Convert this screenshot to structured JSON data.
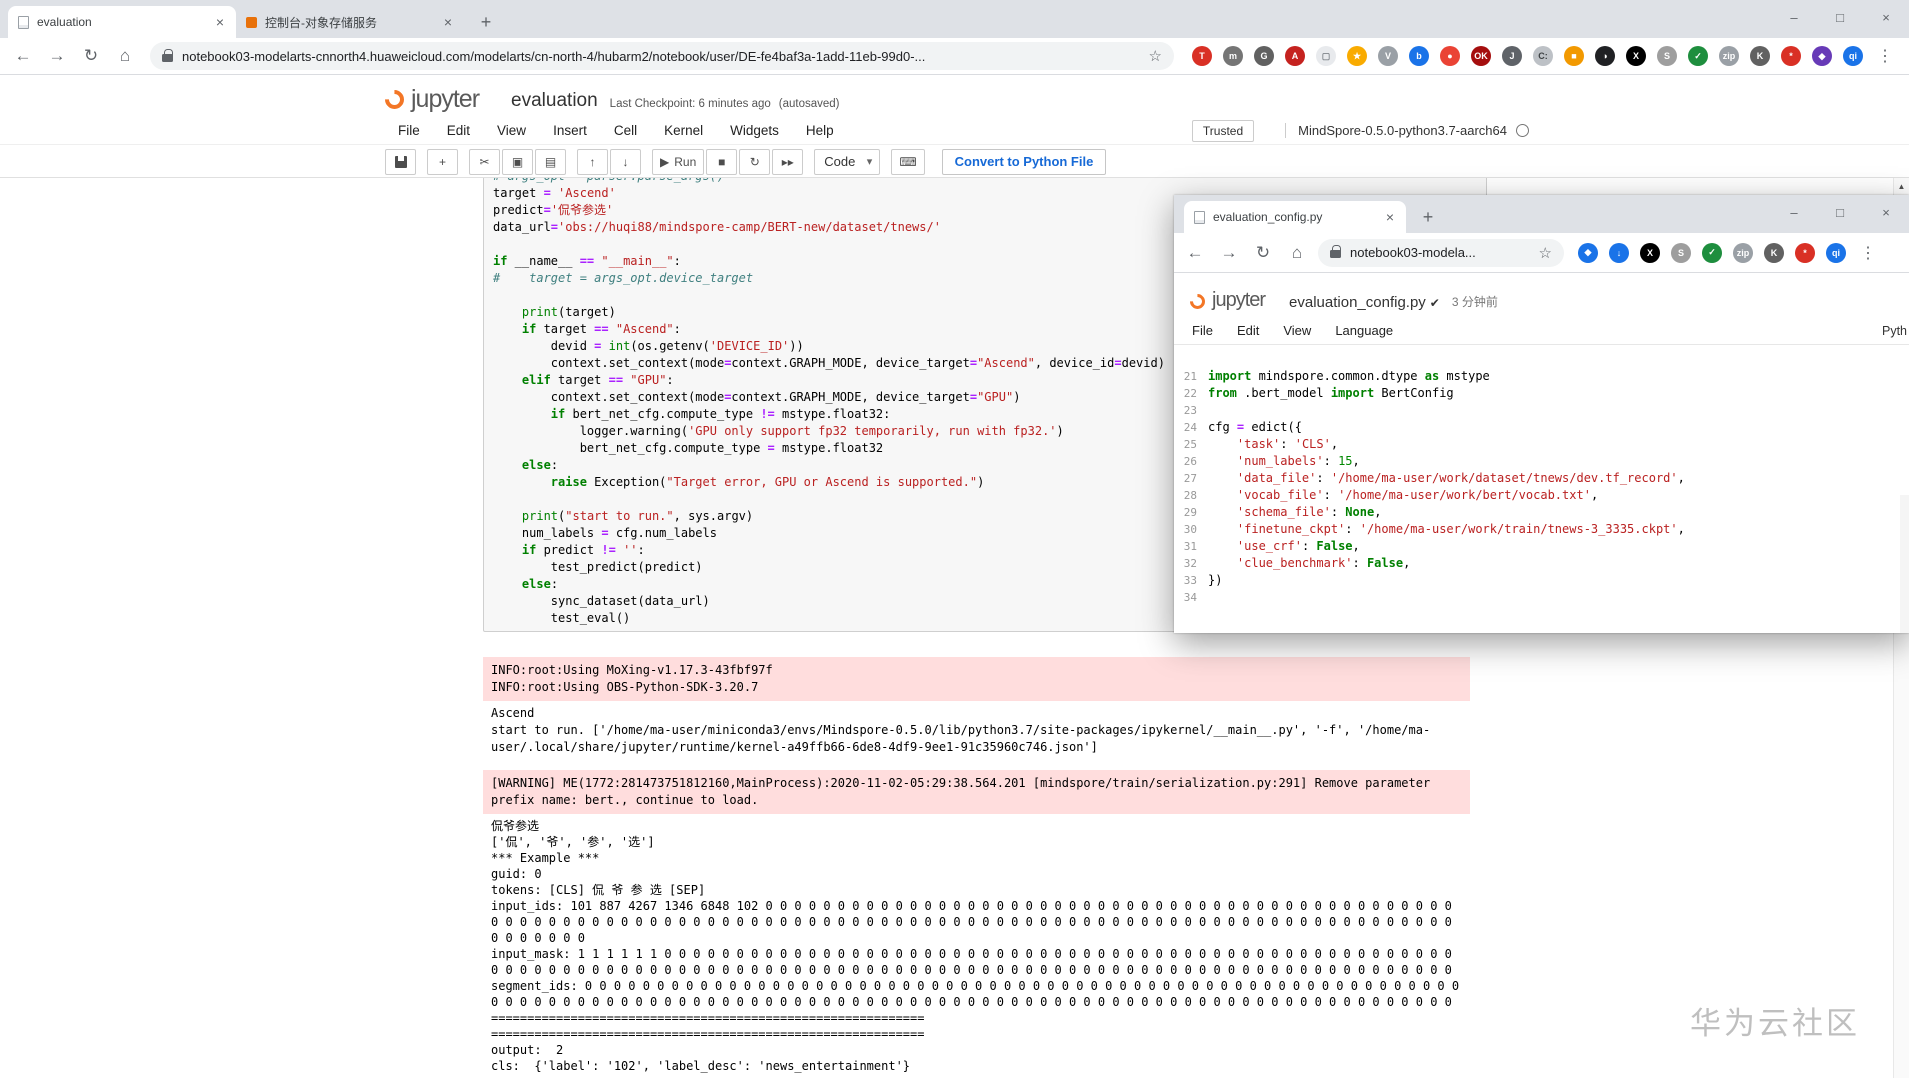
{
  "browser": {
    "tabs": [
      {
        "title": "evaluation"
      },
      {
        "title": "控制台-对象存储服务"
      }
    ],
    "url": "notebook03-modelarts-cnnorth4.huaweicloud.com/modelarts/cn-north-4/hubarm2/notebook/user/DE-fe4baf3a-1add-11eb-99d0-...",
    "extensions": [
      {
        "g": "T",
        "bg": "#d93025"
      },
      {
        "g": "m",
        "bg": "#757575"
      },
      {
        "g": "G",
        "bg": "#616161"
      },
      {
        "g": "A",
        "bg": "#c5221f"
      },
      {
        "g": "▢",
        "bg": "#e8eaed",
        "fg": "#80868b"
      },
      {
        "g": "★",
        "bg": "#f9ab00"
      },
      {
        "g": "V",
        "bg": "#9aa0a6"
      },
      {
        "g": "b",
        "bg": "#1a73e8"
      },
      {
        "g": "●",
        "bg": "#ea4335"
      },
      {
        "g": "OK",
        "bg": "#a50e0e"
      },
      {
        "g": "J",
        "bg": "#5f6368"
      },
      {
        "g": "C:",
        "bg": "#bdc1c6",
        "fg": "#3c4043"
      },
      {
        "g": "■",
        "bg": "#f29900"
      },
      {
        "g": "◑",
        "bg": "#202124"
      },
      {
        "g": "X",
        "bg": "#000000"
      },
      {
        "g": "S",
        "bg": "#9e9e9e"
      },
      {
        "g": "✓",
        "bg": "#1e8e3e"
      },
      {
        "g": "zip",
        "bg": "#9aa0a6"
      },
      {
        "g": "K",
        "bg": "#616161"
      },
      {
        "g": "*",
        "bg": "#d93025"
      },
      {
        "g": "◆",
        "bg": "#673ab7"
      },
      {
        "g": "qi",
        "bg": "#1a73e8"
      }
    ]
  },
  "jupyter": {
    "logo": "jupyter",
    "title": "evaluation",
    "checkpoint": "Last Checkpoint: 6 minutes ago",
    "autosave": "(autosaved)",
    "menus": [
      "File",
      "Edit",
      "View",
      "Insert",
      "Cell",
      "Kernel",
      "Widgets",
      "Help"
    ],
    "trusted_label": "Trusted",
    "kernel_name": "MindSpore-0.5.0-python3.7-aarch64",
    "toolbar": {
      "run_label": "Run",
      "cell_type": "Code",
      "convert_label": "Convert to Python File"
    }
  },
  "cell": {
    "lines": [
      [
        [
          "c",
          "# args_opt = parser.parse_args()"
        ]
      ],
      [
        [
          "t",
          "target "
        ],
        [
          "o",
          "="
        ],
        [
          "t",
          " "
        ],
        [
          "s",
          "'Ascend'"
        ]
      ],
      [
        [
          "t",
          "predict"
        ],
        [
          "o",
          "="
        ],
        [
          "s",
          "'侃爷参选'"
        ]
      ],
      [
        [
          "t",
          "data_url"
        ],
        [
          "o",
          "="
        ],
        [
          "s",
          "'obs://huqi88/mindspore-camp/BERT-new/dataset/tnews/'"
        ]
      ],
      [],
      [
        [
          "k",
          "if"
        ],
        [
          "t",
          " __name__ "
        ],
        [
          "o",
          "=="
        ],
        [
          "t",
          " "
        ],
        [
          "s",
          "\"__main__\""
        ],
        [
          "t",
          ":"
        ]
      ],
      [
        [
          "c",
          "#    target = args_opt.device_target"
        ]
      ],
      [],
      [
        [
          "t",
          "    "
        ],
        [
          "b",
          "print"
        ],
        [
          "t",
          "(target)"
        ]
      ],
      [
        [
          "t",
          "    "
        ],
        [
          "k",
          "if"
        ],
        [
          "t",
          " target "
        ],
        [
          "o",
          "=="
        ],
        [
          "t",
          " "
        ],
        [
          "s",
          "\"Ascend\""
        ],
        [
          "t",
          ":"
        ]
      ],
      [
        [
          "t",
          "        devid "
        ],
        [
          "o",
          "="
        ],
        [
          "t",
          " "
        ],
        [
          "b",
          "int"
        ],
        [
          "t",
          "(os.getenv("
        ],
        [
          "s",
          "'DEVICE_ID'"
        ],
        [
          "t",
          "))"
        ]
      ],
      [
        [
          "t",
          "        context.set_context(mode"
        ],
        [
          "o",
          "="
        ],
        [
          "t",
          "context.GRAPH_MODE, device_target"
        ],
        [
          "o",
          "="
        ],
        [
          "s",
          "\"Ascend\""
        ],
        [
          "t",
          ", device_id"
        ],
        [
          "o",
          "="
        ],
        [
          "t",
          "devid)"
        ]
      ],
      [
        [
          "t",
          "    "
        ],
        [
          "k",
          "elif"
        ],
        [
          "t",
          " target "
        ],
        [
          "o",
          "=="
        ],
        [
          "t",
          " "
        ],
        [
          "s",
          "\"GPU\""
        ],
        [
          "t",
          ":"
        ]
      ],
      [
        [
          "t",
          "        context.set_context(mode"
        ],
        [
          "o",
          "="
        ],
        [
          "t",
          "context.GRAPH_MODE, device_target"
        ],
        [
          "o",
          "="
        ],
        [
          "s",
          "\"GPU\""
        ],
        [
          "t",
          ")"
        ]
      ],
      [
        [
          "t",
          "        "
        ],
        [
          "k",
          "if"
        ],
        [
          "t",
          " bert_net_cfg.compute_type "
        ],
        [
          "o",
          "!="
        ],
        [
          "t",
          " mstype.float32:"
        ]
      ],
      [
        [
          "t",
          "            logger.warning("
        ],
        [
          "s",
          "'GPU only support fp32 temporarily, run with fp32.'"
        ],
        [
          "t",
          ")"
        ]
      ],
      [
        [
          "t",
          "            bert_net_cfg.compute_type "
        ],
        [
          "o",
          "="
        ],
        [
          "t",
          " mstype.float32"
        ]
      ],
      [
        [
          "t",
          "    "
        ],
        [
          "k",
          "else"
        ],
        [
          "t",
          ":"
        ]
      ],
      [
        [
          "t",
          "        "
        ],
        [
          "k",
          "raise"
        ],
        [
          "t",
          " Exception("
        ],
        [
          "s",
          "\"Target error, GPU or Ascend is supported.\""
        ],
        [
          "t",
          ")"
        ]
      ],
      [],
      [
        [
          "t",
          "    "
        ],
        [
          "b",
          "print"
        ],
        [
          "t",
          "("
        ],
        [
          "s",
          "\"start to run.\""
        ],
        [
          "t",
          ", sys.argv)"
        ]
      ],
      [
        [
          "t",
          "    num_labels "
        ],
        [
          "o",
          "="
        ],
        [
          "t",
          " cfg.num_labels"
        ]
      ],
      [
        [
          "t",
          "    "
        ],
        [
          "k",
          "if"
        ],
        [
          "t",
          " predict "
        ],
        [
          "o",
          "!="
        ],
        [
          "t",
          " "
        ],
        [
          "s",
          "''"
        ],
        [
          "t",
          ":"
        ]
      ],
      [
        [
          "t",
          "        test_predict(predict)"
        ]
      ],
      [
        [
          "t",
          "    "
        ],
        [
          "k",
          "else"
        ],
        [
          "t",
          ":"
        ]
      ],
      [
        [
          "t",
          "        sync_dataset(data_url)"
        ]
      ],
      [
        [
          "t",
          "        test_eval()"
        ]
      ]
    ]
  },
  "outputs": [
    {
      "type": "stderr",
      "text": "INFO:root:Using MoXing-v1.17.3-43fbf97f\nINFO:root:Using OBS-Python-SDK-3.20.7"
    },
    {
      "type": "stdout",
      "text": "Ascend\nstart to run. ['/home/ma-user/miniconda3/envs/Mindspore-0.5.0/lib/python3.7/site-packages/ipykernel/__main__.py', '-f', '/home/ma-user/.local/share/jupyter/runtime/kernel-a49ffb66-6de8-4df9-9ee1-91c35960c746.json']"
    },
    {
      "type": "stderr",
      "text": "[WARNING] ME(1772:281473751812160,MainProcess):2020-11-02-05:29:38.564.201 [mindspore/train/serialization.py:291] Remove parameter prefix name: bert., continue to load."
    },
    {
      "type": "stdout",
      "text": "侃爷参选\n['侃', '爷', '参', '选']\n*** Example ***\nguid: 0\ntokens: [CLS] 侃 爷 参 选 [SEP]\ninput_ids: 101 887 4267 1346 6848 102 0 0 0 0 0 0 0 0 0 0 0 0 0 0 0 0 0 0 0 0 0 0 0 0 0 0 0 0 0 0 0 0 0 0 0 0 0 0 0 0 0 0 0 0 0 0 0 0 0 0 0 0 0 0 0 0 0 0 0 0 0 0 0 0 0 0 0 0 0 0 0 0 0 0 0 0 0 0 0 0 0 0 0 0 0 0 0 0 0 0 0 0 0 0 0 0 0 0 0 0 0 0 0 0 0 0 0 0 0 0 0 0 0 0 0 0 0 0 0 0 0 0\ninput_mask: 1 1 1 1 1 1 0 0 0 0 0 0 0 0 0 0 0 0 0 0 0 0 0 0 0 0 0 0 0 0 0 0 0 0 0 0 0 0 0 0 0 0 0 0 0 0 0 0 0 0 0 0 0 0 0 0 0 0 0 0 0 0 0 0 0 0 0 0 0 0 0 0 0 0 0 0 0 0 0 0 0 0 0 0 0 0 0 0 0 0 0 0 0 0 0 0 0 0 0 0 0 0 0 0 0 0 0 0 0 0 0 0 0 0 0 0 0 0 0 0 0 0 0 0 0 0 0 0\nsegment_ids: 0 0 0 0 0 0 0 0 0 0 0 0 0 0 0 0 0 0 0 0 0 0 0 0 0 0 0 0 0 0 0 0 0 0 0 0 0 0 0 0 0 0 0 0 0 0 0 0 0 0 0 0 0 0 0 0 0 0 0 0 0 0 0 0 0 0 0 0 0 0 0 0 0 0 0 0 0 0 0 0 0 0 0 0 0 0 0 0 0 0 0 0 0 0 0 0 0 0 0 0 0 0 0 0 0 0 0 0 0 0 0 0 0 0 0 0 0 0 0 0 0 0 0 0 0 0 0 0\n============================================================\n============================================================\noutput:  2\ncls:  {'label': '102', 'label_desc': 'news_entertainment'}"
    }
  ],
  "popup": {
    "tab_title": "evaluation_config.py",
    "url": "notebook03-modela...",
    "logo": "jupyter",
    "title": "evaluation_config.py",
    "saved_check": "✔",
    "saved_time": "3 分钟前",
    "menus": [
      "File",
      "Edit",
      "View",
      "Language"
    ],
    "lang_indicator": "Pyth",
    "extensions": [
      {
        "g": "◆",
        "bg": "#1a73e8"
      },
      {
        "g": "↓",
        "bg": "#1a73e8"
      },
      {
        "g": "X",
        "bg": "#000000"
      },
      {
        "g": "S",
        "bg": "#9e9e9e"
      },
      {
        "g": "✓",
        "bg": "#1e8e3e"
      },
      {
        "g": "zip",
        "bg": "#9aa0a6"
      },
      {
        "g": "K",
        "bg": "#616161"
      },
      {
        "g": "*",
        "bg": "#d93025"
      },
      {
        "g": "qi",
        "bg": "#1a73e8"
      }
    ],
    "editor": {
      "lines": [
        {
          "n": "21",
          "s": [
            [
              "k",
              "import"
            ],
            [
              "t",
              " mindspore.common.dtype "
            ],
            [
              "k",
              "as"
            ],
            [
              "t",
              " mstype"
            ]
          ]
        },
        {
          "n": "22",
          "s": [
            [
              "k",
              "from"
            ],
            [
              "t",
              " .bert_model "
            ],
            [
              "k",
              "import"
            ],
            [
              "t",
              " BertConfig"
            ]
          ]
        },
        {
          "n": "23",
          "s": []
        },
        {
          "n": "24",
          "s": [
            [
              "t",
              "cfg "
            ],
            [
              "o",
              "="
            ],
            [
              "t",
              " edict({"
            ]
          ]
        },
        {
          "n": "25",
          "s": [
            [
              "t",
              "    "
            ],
            [
              "s",
              "'task'"
            ],
            [
              "t",
              ": "
            ],
            [
              "s",
              "'CLS'"
            ],
            [
              "t",
              ","
            ]
          ]
        },
        {
          "n": "26",
          "s": [
            [
              "t",
              "    "
            ],
            [
              "s",
              "'num_labels'"
            ],
            [
              "t",
              ": "
            ],
            [
              "n",
              "15"
            ],
            [
              "t",
              ","
            ]
          ]
        },
        {
          "n": "27",
          "s": [
            [
              "t",
              "    "
            ],
            [
              "s",
              "'data_file'"
            ],
            [
              "t",
              ": "
            ],
            [
              "s",
              "'/home/ma-user/work/dataset/tnews/dev.tf_record'"
            ],
            [
              "t",
              ","
            ]
          ]
        },
        {
          "n": "28",
          "s": [
            [
              "t",
              "    "
            ],
            [
              "s",
              "'vocab_file'"
            ],
            [
              "t",
              ": "
            ],
            [
              "s",
              "'/home/ma-user/work/bert/vocab.txt'"
            ],
            [
              "t",
              ","
            ]
          ]
        },
        {
          "n": "29",
          "s": [
            [
              "t",
              "    "
            ],
            [
              "s",
              "'schema_file'"
            ],
            [
              "t",
              ": "
            ],
            [
              "k",
              "None"
            ],
            [
              "t",
              ","
            ]
          ]
        },
        {
          "n": "30",
          "s": [
            [
              "t",
              "    "
            ],
            [
              "s",
              "'finetune_ckpt'"
            ],
            [
              "t",
              ": "
            ],
            [
              "s",
              "'/home/ma-user/work/train/tnews-3_3335.ckpt'"
            ],
            [
              "t",
              ","
            ]
          ]
        },
        {
          "n": "31",
          "s": [
            [
              "t",
              "    "
            ],
            [
              "s",
              "'use_crf'"
            ],
            [
              "t",
              ": "
            ],
            [
              "k",
              "False"
            ],
            [
              "t",
              ","
            ]
          ]
        },
        {
          "n": "32",
          "s": [
            [
              "t",
              "    "
            ],
            [
              "s",
              "'clue_benchmark'"
            ],
            [
              "t",
              ": "
            ],
            [
              "k",
              "False"
            ],
            [
              "t",
              ","
            ]
          ]
        },
        {
          "n": "33",
          "s": [
            [
              "t",
              "})"
            ]
          ]
        },
        {
          "n": "34",
          "s": []
        }
      ]
    }
  },
  "watermark": "华为云社区",
  "colors": {
    "jupyter_orange": "#f37626",
    "stderr_bg": "#ffdddd",
    "link_blue": "#1669d6"
  }
}
